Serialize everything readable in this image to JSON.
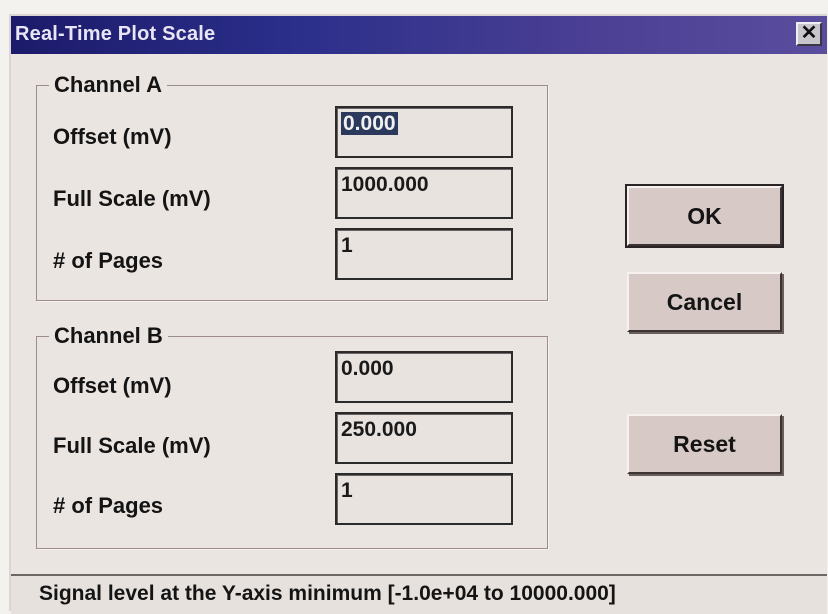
{
  "window": {
    "title": "Real-Time Plot Scale",
    "close_glyph": "✕"
  },
  "channel_a": {
    "title": "Channel A",
    "offset_label": "Offset (mV)",
    "offset_value": "0.000",
    "full_scale_label": "Full Scale (mV)",
    "full_scale_value": "1000.000",
    "pages_label": "# of Pages",
    "pages_value": "1"
  },
  "channel_b": {
    "title": "Channel B",
    "offset_label": "Offset (mV)",
    "offset_value": "0.000",
    "full_scale_label": "Full Scale (mV)",
    "full_scale_value": "250.000",
    "pages_label": "# of Pages",
    "pages_value": "1"
  },
  "buttons": {
    "ok": "OK",
    "cancel": "Cancel",
    "reset": "Reset"
  },
  "status": {
    "text": "Signal level at the Y-axis minimum [-1.0e+04 to 10000.000]"
  },
  "colors": {
    "titlebar": "#2b2f8a",
    "dialog_bg": "#ebe5e1",
    "button_face": "#d6c9c6"
  },
  "icons": {
    "close": "close-icon"
  }
}
